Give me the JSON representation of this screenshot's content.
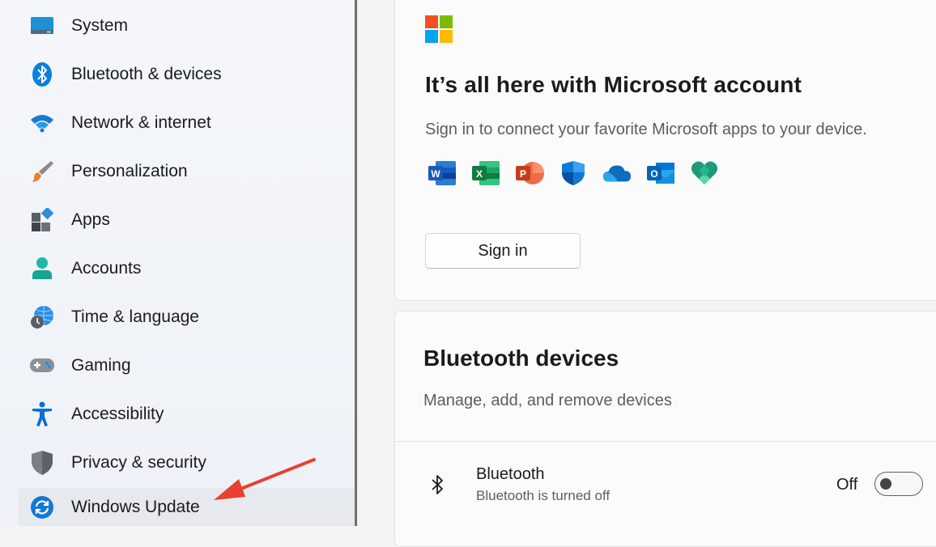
{
  "sidebar": {
    "items": [
      {
        "label": "System",
        "icon": "system-icon"
      },
      {
        "label": "Bluetooth & devices",
        "icon": "bluetooth-icon"
      },
      {
        "label": "Network & internet",
        "icon": "wifi-icon"
      },
      {
        "label": "Personalization",
        "icon": "paintbrush-icon"
      },
      {
        "label": "Apps",
        "icon": "apps-icon"
      },
      {
        "label": "Accounts",
        "icon": "person-icon"
      },
      {
        "label": "Time & language",
        "icon": "globe-clock-icon"
      },
      {
        "label": "Gaming",
        "icon": "gamepad-icon"
      },
      {
        "label": "Accessibility",
        "icon": "accessibility-icon"
      },
      {
        "label": "Privacy & security",
        "icon": "shield-icon"
      },
      {
        "label": "Windows Update",
        "icon": "sync-icon",
        "selected": true
      }
    ]
  },
  "account_card": {
    "title": "It’s all here with Microsoft account",
    "subtitle": "Sign in to connect your favorite Microsoft apps to your device.",
    "apps": [
      "word-icon",
      "excel-icon",
      "powerpoint-icon",
      "defender-icon",
      "onedrive-icon",
      "outlook-icon",
      "family-icon"
    ],
    "signin_label": "Sign in"
  },
  "bluetooth_card": {
    "title": "Bluetooth devices",
    "subtitle": "Manage, add, and remove devices",
    "row_title": "Bluetooth",
    "row_desc": "Bluetooth is turned off",
    "toggle_state": "Off"
  },
  "colors": {
    "accent": "#0067c0",
    "annotation_arrow": "#e8412f"
  }
}
